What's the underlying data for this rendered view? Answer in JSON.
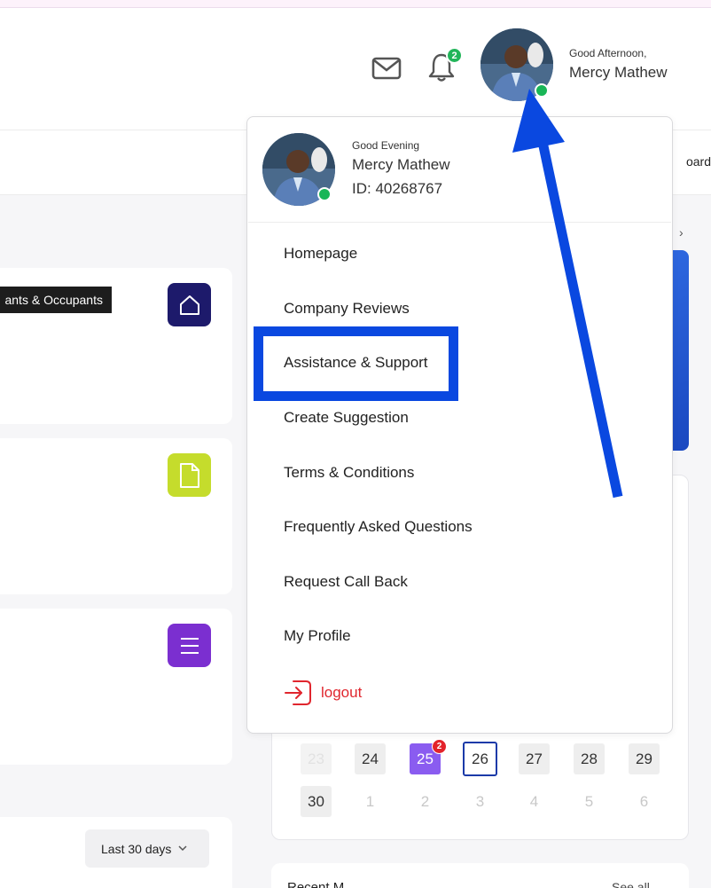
{
  "header": {
    "notification_count": "2",
    "greeting": "Good Afternoon,",
    "user_name": "Mercy Mathew"
  },
  "subbar": {
    "partial_text": "oard"
  },
  "tooltip": {
    "text": "ants & Occupants"
  },
  "tiles": [
    {
      "icon": "home-icon",
      "color": "#1d1a6b"
    },
    {
      "icon": "document-icon",
      "color": "#c5dc2c"
    },
    {
      "icon": "list-icon",
      "color": "#7b2fd0"
    }
  ],
  "filter": {
    "label": "Last 30 days"
  },
  "dropdown": {
    "greeting": "Good Evening",
    "name": "Mercy Mathew",
    "id_text": "ID: 40268767",
    "items": [
      "Homepage",
      "Company Reviews",
      "Assistance & Support",
      "Create Suggestion",
      "Terms & Conditions",
      "Frequently Asked Questions",
      "Request Call Back",
      "My Profile"
    ],
    "logout": "logout"
  },
  "calendar": {
    "row1": [
      "23",
      "24",
      "25",
      "26",
      "27",
      "28",
      "29"
    ],
    "row2": [
      "30",
      "1",
      "2",
      "3",
      "4",
      "5",
      "6"
    ],
    "selected_badge": "2"
  },
  "bottom": {
    "title": "Recent M",
    "link": "See all"
  },
  "colors": {
    "accent_blue": "#0a48e0",
    "online": "#19b657",
    "logout_red": "#e0262e",
    "selected_day": "#8a5cf0"
  }
}
